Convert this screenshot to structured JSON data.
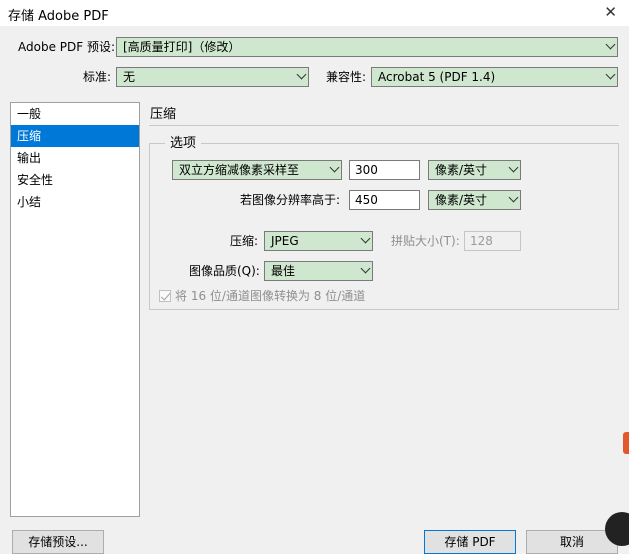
{
  "window": {
    "title": "存储 Adobe PDF",
    "close_glyph": "✕"
  },
  "header": {
    "preset_label": "Adobe PDF 预设:",
    "preset_value": "[高质量打印]（修改）",
    "standard_label": "标准:",
    "standard_value": "无",
    "compat_label": "兼容性:",
    "compat_value": "Acrobat 5 (PDF 1.4)"
  },
  "nav": {
    "items": [
      {
        "label": "一般"
      },
      {
        "label": "压缩"
      },
      {
        "label": "输出"
      },
      {
        "label": "安全性"
      },
      {
        "label": "小结"
      }
    ],
    "active": "压缩"
  },
  "section": {
    "title": "压缩",
    "options_legend": "选项",
    "resample_method": "双立方缩减像素采样至",
    "resample_value": "300",
    "resample_unit": "像素/英寸",
    "threshold_label": "若图像分辨率高于:",
    "threshold_value": "450",
    "threshold_unit": "像素/英寸",
    "compression_label": "压缩:",
    "compression_value": "JPEG",
    "tile_label": "拼贴大小(T):",
    "tile_value": "128",
    "quality_label": "图像品质(Q):",
    "quality_value": "最佳",
    "convert_16bit_label": "将 16 位/通道图像转换为 8 位/通道",
    "convert_16bit_checked": true
  },
  "footer": {
    "save_preset": "存储预设...",
    "save_pdf": "存储 PDF",
    "cancel": "取消"
  },
  "colors": {
    "field_bg": "#cfe7cf",
    "selection": "#0078d7",
    "dialog_bg": "#f0f0f0"
  }
}
